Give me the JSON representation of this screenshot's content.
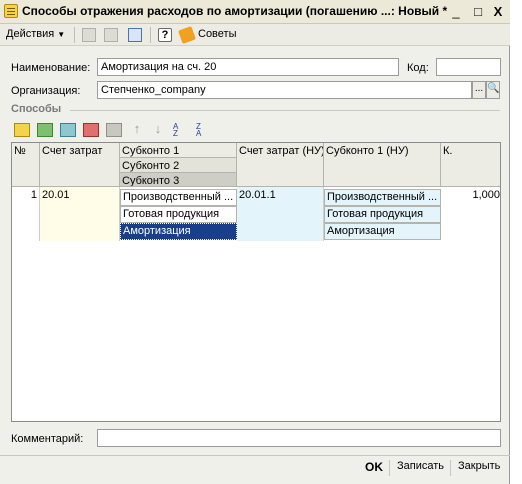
{
  "window": {
    "title": "Способы отражения расходов по амортизации (погашению ...: Новый *",
    "controls": {
      "minimize": "_",
      "maximize": "□",
      "close": "X"
    }
  },
  "toolbar": {
    "actions_label": "Действия",
    "help_label": "?",
    "tips_label": "Советы"
  },
  "form": {
    "name_label": "Наименование:",
    "name_value": "Амортизация на сч. 20",
    "code_label": "Код:",
    "code_value": "",
    "org_label": "Организация:",
    "org_value": "Степченко_company",
    "select_btn": "...",
    "search_icon": "search-icon"
  },
  "methods": {
    "section_title": "Способы",
    "columns": {
      "num": "№",
      "account": "Счет затрат",
      "subconto1": "Субконто 1",
      "subconto2": "Субконто 2",
      "subconto3": "Субконто 3",
      "account_nu": "Счет затрат (НУ)",
      "subconto1_nu": "Субконто 1 (НУ)",
      "coef": "К."
    },
    "rows": [
      {
        "num": "1",
        "account": "20.01",
        "subconto1": "Производственный ...",
        "subconto2": "Готовая продукция",
        "subconto3": "Амортизация",
        "account_nu": "20.01.1",
        "subconto1_nu": "Производственный ...",
        "subconto2_nu": "Готовая продукция",
        "subconto3_nu": "Амортизация",
        "coef": "1,000"
      }
    ]
  },
  "comment": {
    "label": "Комментарий:",
    "value": ""
  },
  "footer": {
    "ok": "OK",
    "save": "Записать",
    "close": "Закрыть"
  },
  "colors": {
    "selection": "#1a3f8a",
    "nu_column": "#e4f4fb",
    "account_column": "#fffde8"
  }
}
